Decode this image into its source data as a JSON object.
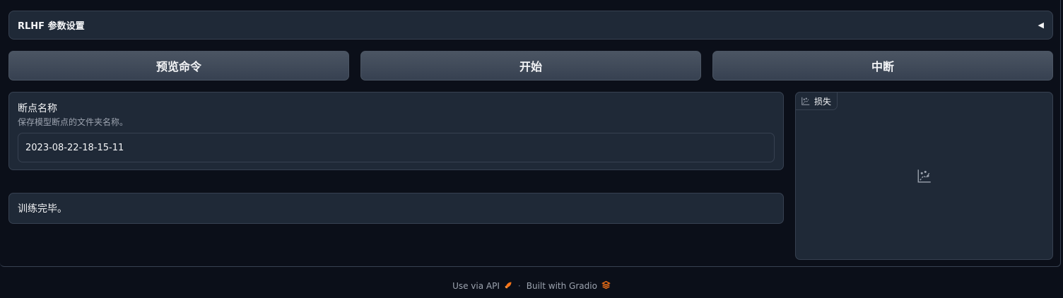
{
  "accordion": {
    "title": "RLHF 参数设置",
    "arrow": "◀"
  },
  "buttons": {
    "preview": "预览命令",
    "start": "开始",
    "stop": "中断"
  },
  "checkpoint": {
    "label": "断点名称",
    "info": "保存模型断点的文件夹名称。",
    "value": "2023-08-22-18-15-11"
  },
  "status": {
    "text": "训练完毕。"
  },
  "plot": {
    "label": "损失"
  },
  "footer": {
    "api": "Use via API",
    "separator": "·",
    "built_with": "Built with Gradio"
  },
  "colors": {
    "background": "#0b0f19",
    "panel": "#1f2937",
    "border": "#374151",
    "accent": "#f97316"
  }
}
